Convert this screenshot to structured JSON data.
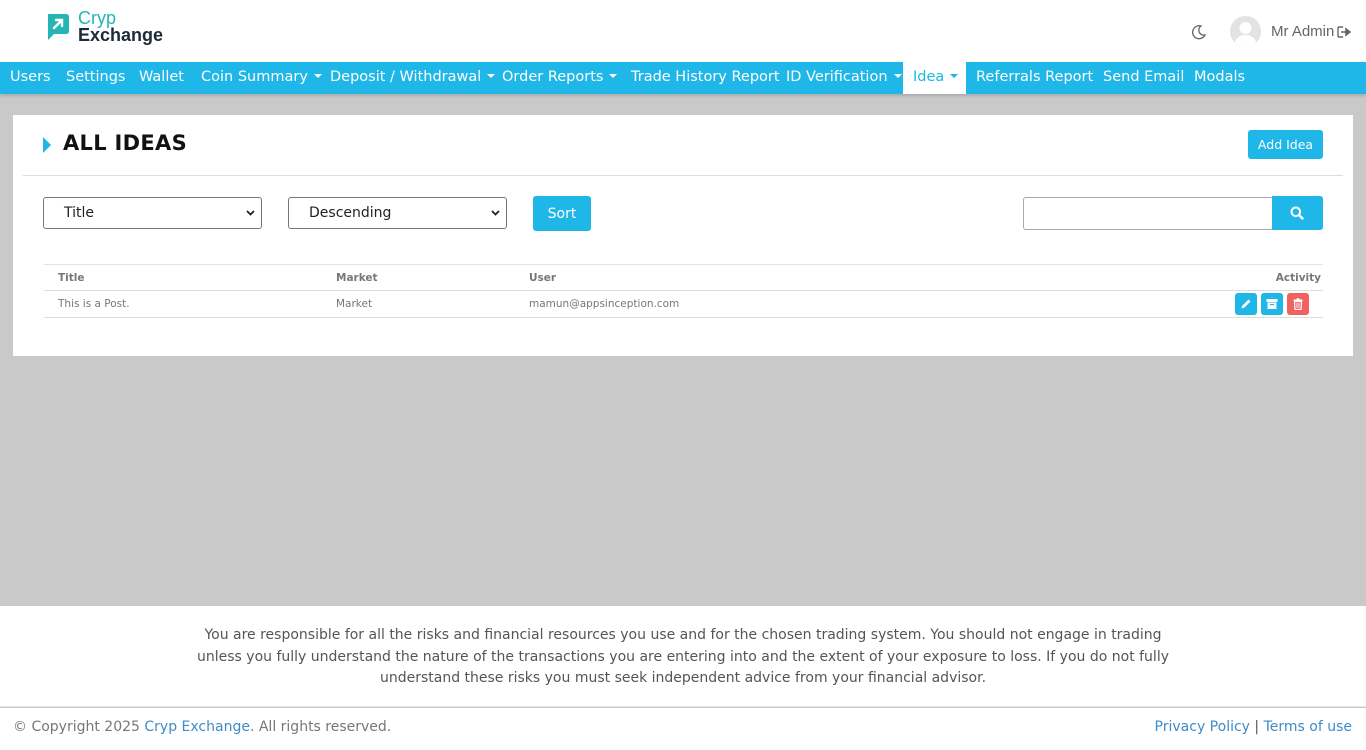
{
  "header": {
    "logo_line1": "Cryp",
    "logo_line2": "Exchange",
    "user_name": "Mr Admin"
  },
  "nav": {
    "items": [
      {
        "label": "Users"
      },
      {
        "label": "Settings"
      },
      {
        "label": "Wallet"
      },
      {
        "label": "Coin Summary"
      },
      {
        "label": "Deposit / Withdrawal"
      },
      {
        "label": "Order Reports"
      },
      {
        "label": "Trade History Report"
      },
      {
        "label": "ID Verification"
      },
      {
        "label": "Idea"
      },
      {
        "label": "Referrals Report"
      },
      {
        "label": "Send Email"
      },
      {
        "label": "Modals"
      }
    ],
    "active": "Idea"
  },
  "panel": {
    "title": "ALL IDEAS",
    "add_label": "Add Idea",
    "sort_field": "Title",
    "sort_order": "Descending",
    "sort_label": "Sort",
    "search_value": ""
  },
  "table": {
    "headers": {
      "title": "Title",
      "market": "Market",
      "user": "User",
      "activity": "Activity"
    },
    "rows": [
      {
        "title": "This is a Post.",
        "market": "Market",
        "user": "mamun@appsinception.com"
      }
    ]
  },
  "footer": {
    "disclaimer": "You are responsible for all the risks and financial resources you use and for the chosen trading system. You should not engage in trading unless you fully understand the nature of the transactions you are entering into and the extent of your exposure to loss. If you do not fully understand these risks you must seek independent advice from your financial advisor.",
    "copyright_prefix": "© Copyright 2025 ",
    "copyright_brand": "Cryp Exchange",
    "copyright_suffix": ". All rights reserved.",
    "privacy": "Privacy Policy",
    "separator": "|",
    "terms": "Terms of use"
  },
  "colors": {
    "accent": "#1fb6e8",
    "danger": "#f0625f",
    "logo_teal": "#25b5b5"
  }
}
